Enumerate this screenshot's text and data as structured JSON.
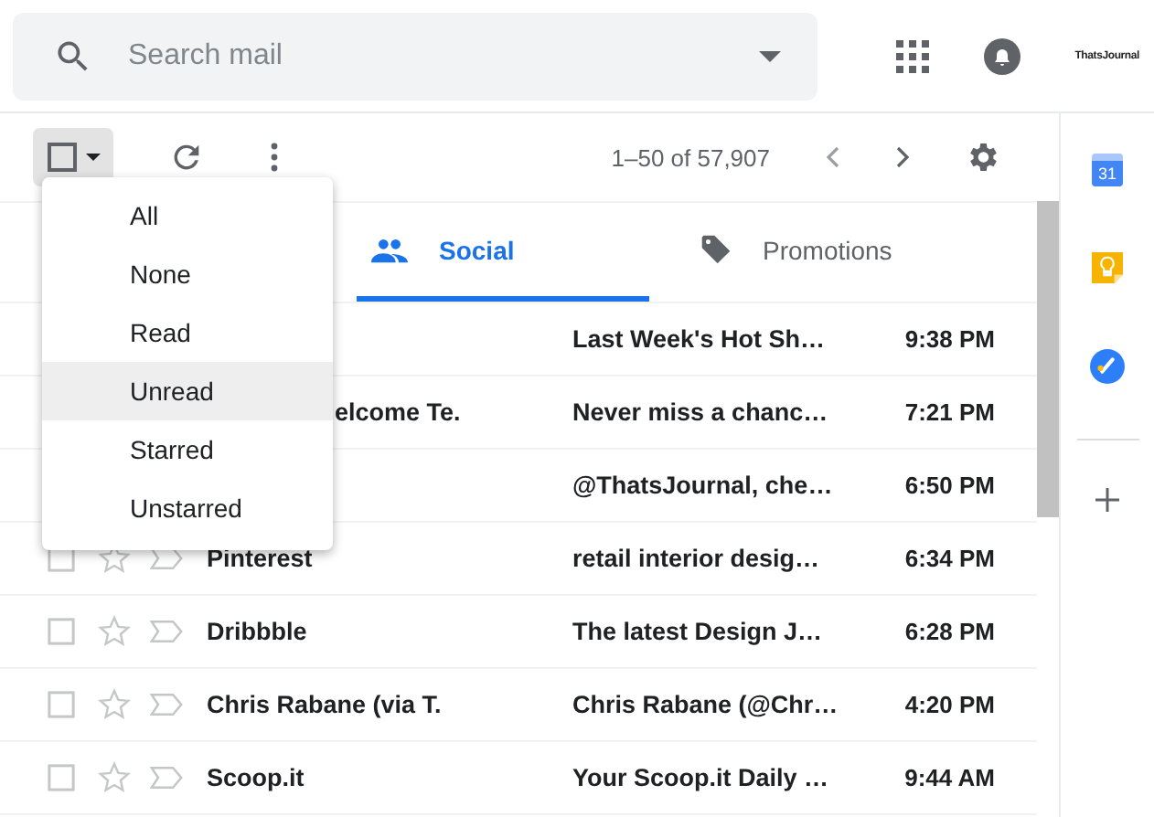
{
  "search": {
    "placeholder": "Search mail"
  },
  "account": {
    "logo_text": "ThatsJournal"
  },
  "toolbar": {
    "counter": "1–50 of 57,907"
  },
  "select_menu": {
    "items": [
      {
        "label": "All",
        "selected": false
      },
      {
        "label": "None",
        "selected": false
      },
      {
        "label": "Read",
        "selected": false
      },
      {
        "label": "Unread",
        "selected": true
      },
      {
        "label": "Starred",
        "selected": false
      },
      {
        "label": "Unstarred",
        "selected": false
      }
    ]
  },
  "tabs": [
    {
      "label": "Social",
      "kind": "social",
      "selected": true
    },
    {
      "label": "Promotions",
      "kind": "promotions",
      "selected": false
    }
  ],
  "rows": [
    {
      "kind": "covered",
      "subject": "Last Week's Hot Sh…",
      "time": "9:38 PM"
    },
    {
      "kind": "covered",
      "sender": "elcome Te.",
      "subject": "Never miss a chanc…",
      "time": "7:21 PM"
    },
    {
      "kind": "covered",
      "subject": "@ThatsJournal, che…",
      "time": "6:50 PM"
    },
    {
      "kind": "full",
      "sender": "Pinterest",
      "subject": "retail interior desig…",
      "time": "6:34 PM"
    },
    {
      "kind": "full",
      "sender": "Dribbble",
      "subject": "The latest Design J…",
      "time": "6:28 PM"
    },
    {
      "kind": "full",
      "sender": "Chris Rabane (via T.",
      "subject": "Chris Rabane (@Chr…",
      "time": "4:20 PM"
    },
    {
      "kind": "full",
      "sender": "Scoop.it",
      "subject": "Your Scoop.it Daily …",
      "time": "9:44 AM"
    }
  ],
  "side_panel": {
    "calendar_day": "31"
  }
}
